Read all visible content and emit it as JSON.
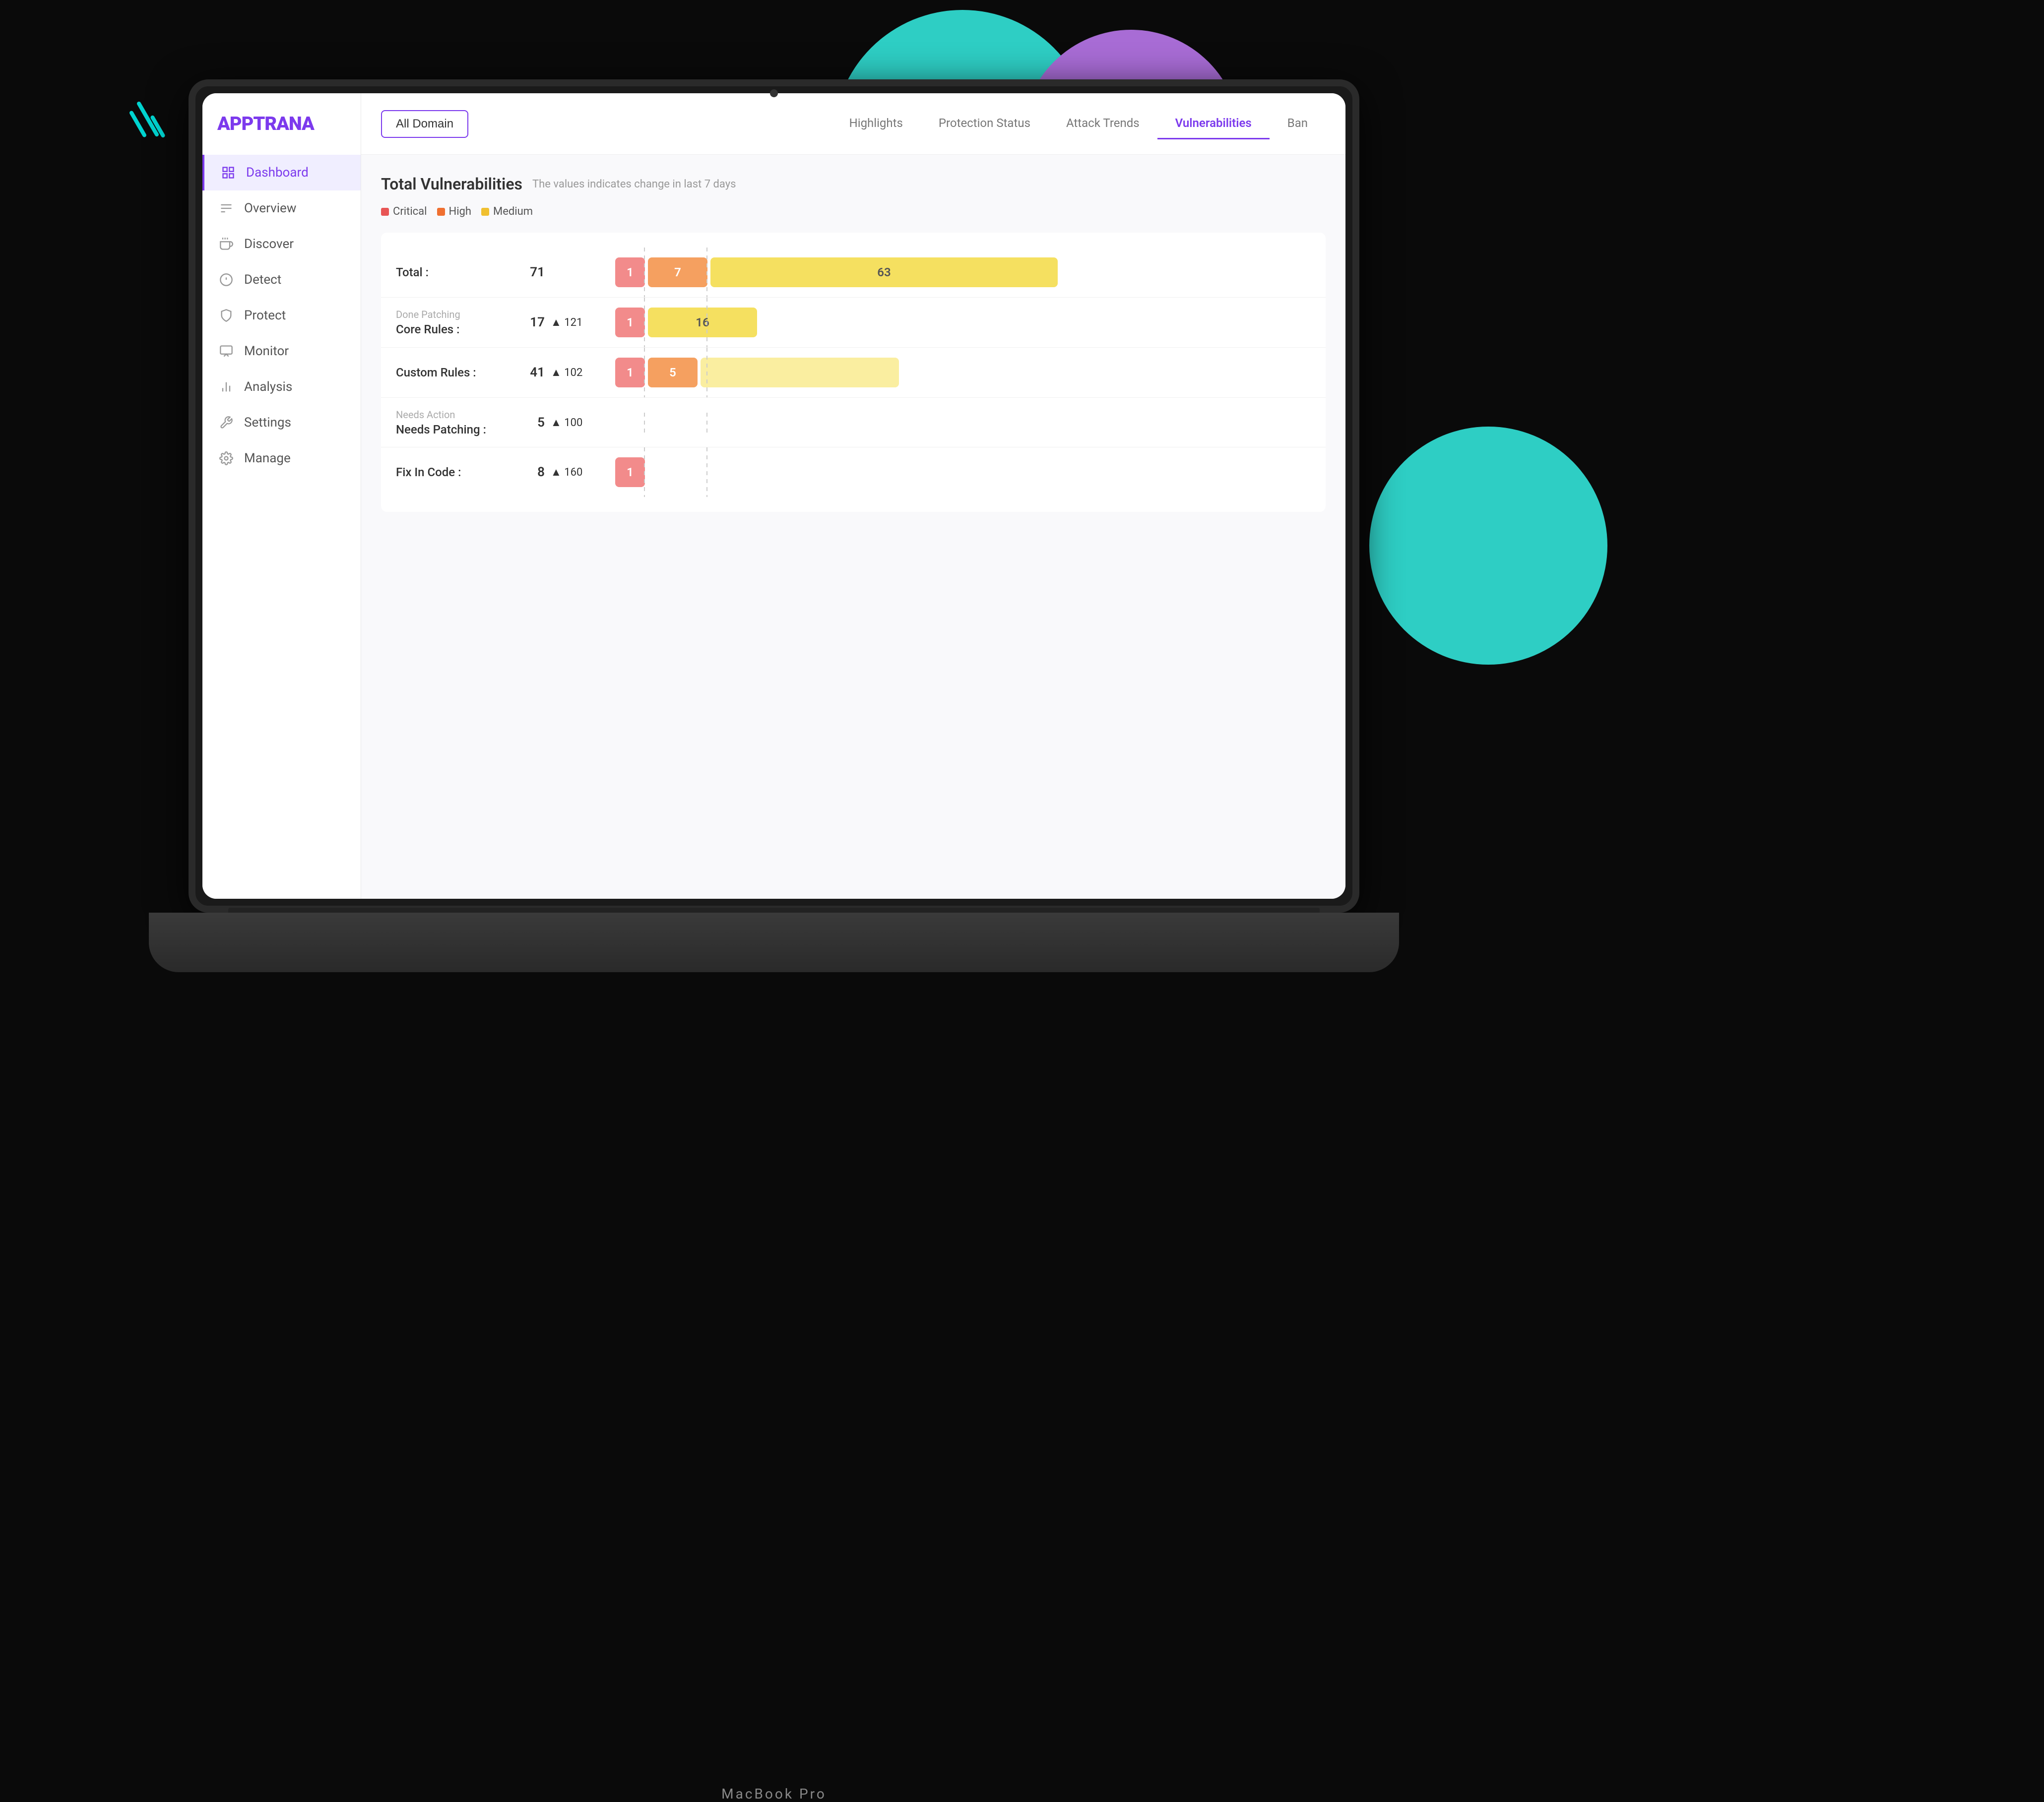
{
  "app": {
    "name": "APPTRANA",
    "laptop_model": "MacBook Pro"
  },
  "sidebar": {
    "items": [
      {
        "id": "dashboard",
        "label": "Dashboard",
        "icon": "grid-icon",
        "active": true
      },
      {
        "id": "overview",
        "label": "Overview",
        "icon": "menu-icon",
        "active": false
      },
      {
        "id": "discover",
        "label": "Discover",
        "icon": "hand-icon",
        "active": false
      },
      {
        "id": "detect",
        "label": "Detect",
        "icon": "gear-icon",
        "active": false
      },
      {
        "id": "protect",
        "label": "Protect",
        "icon": "shield-icon",
        "active": false
      },
      {
        "id": "monitor",
        "label": "Monitor",
        "icon": "monitor-icon",
        "active": false
      },
      {
        "id": "analysis",
        "label": "Analysis",
        "icon": "chart-icon",
        "active": false
      },
      {
        "id": "settings",
        "label": "Settings",
        "icon": "wrench-icon",
        "active": false
      },
      {
        "id": "manage",
        "label": "Manage",
        "icon": "cog-icon",
        "active": false
      }
    ]
  },
  "header": {
    "domain_btn": "All Domain",
    "tabs": [
      {
        "label": "Highlights",
        "active": false
      },
      {
        "label": "Protection Status",
        "active": false
      },
      {
        "label": "Attack Trends",
        "active": false
      },
      {
        "label": "Vulnerabilities",
        "active": true
      },
      {
        "label": "Ban",
        "active": false
      }
    ]
  },
  "vulnerabilities": {
    "title": "Total Vulnerabilities",
    "subtitle": "The values indicates change in last 7 days",
    "legend": [
      {
        "label": "Critical",
        "type": "critical"
      },
      {
        "label": "High",
        "type": "high"
      },
      {
        "label": "Medium",
        "type": "medium"
      }
    ],
    "rows": [
      {
        "id": "total",
        "label": "Total :",
        "sublabel": "",
        "value": "71",
        "trend": "",
        "critical": 1,
        "high": 7,
        "medium": 63,
        "bar_widths": {
          "critical": 52,
          "high": 120,
          "medium": 400
        }
      },
      {
        "id": "core-rules",
        "label": "Core Rules :",
        "sublabel": "Done Patching",
        "value": "17",
        "trend": "▲ 121",
        "critical": 1,
        "high": 0,
        "medium": 16,
        "bar_widths": {
          "critical": 52,
          "high": 0,
          "medium": 220
        }
      },
      {
        "id": "custom-rules",
        "label": "Custom Rules :",
        "sublabel": "",
        "value": "41",
        "trend": "▲ 102",
        "critical": 1,
        "high": 5,
        "medium": 0,
        "bar_widths": {
          "critical": 52,
          "high": 100,
          "medium": 320
        }
      },
      {
        "id": "needs-patching",
        "label": "Needs Patching :",
        "sublabel": "Needs Action",
        "value": "5",
        "trend": "▲ 100",
        "critical": 0,
        "high": 0,
        "medium": 0,
        "bar_widths": {
          "critical": 0,
          "high": 0,
          "medium": 0
        }
      },
      {
        "id": "fix-in-code",
        "label": "Fix In Code :",
        "sublabel": "",
        "value": "8",
        "trend": "▲ 160",
        "critical": 1,
        "high": 0,
        "medium": 0,
        "bar_widths": {
          "critical": 52,
          "high": 0,
          "medium": 0
        }
      }
    ]
  }
}
